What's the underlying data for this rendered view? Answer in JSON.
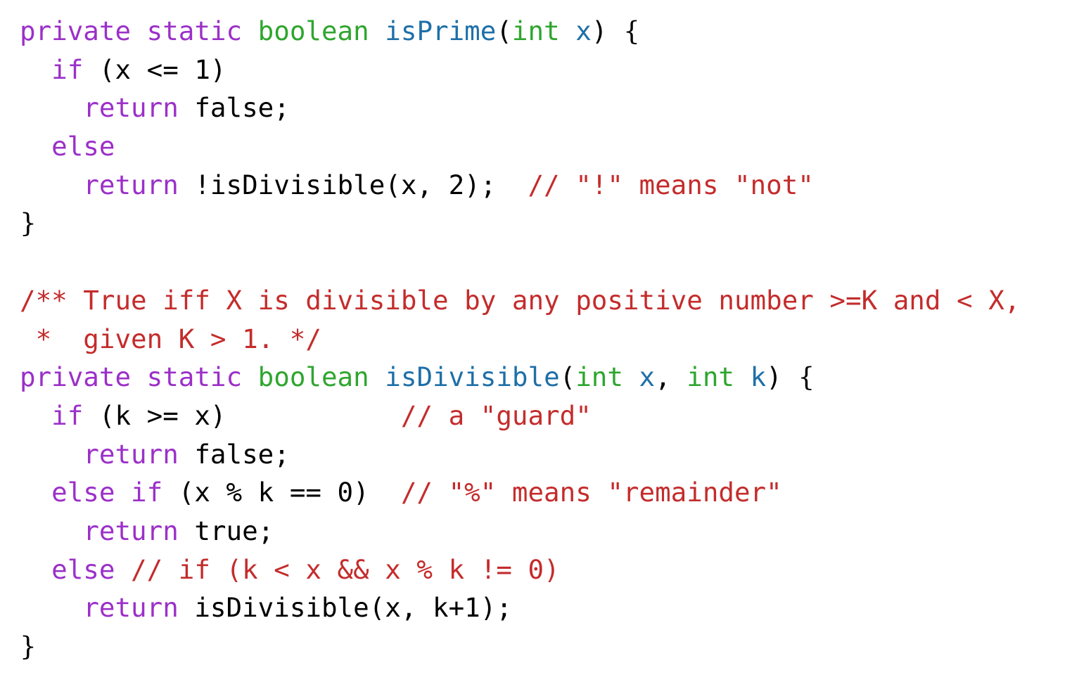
{
  "colors": {
    "keyword": "#9b30c8",
    "type": "#2ea62e",
    "function": "#1e6fa8",
    "comment": "#c42c2c",
    "plain": "#000000"
  },
  "lines": [
    {
      "indent": "",
      "tokens": [
        {
          "text": "private",
          "kind": "keyword"
        },
        {
          "text": " ",
          "kind": "plain"
        },
        {
          "text": "static",
          "kind": "keyword"
        },
        {
          "text": " ",
          "kind": "plain"
        },
        {
          "text": "boolean",
          "kind": "type"
        },
        {
          "text": " ",
          "kind": "plain"
        },
        {
          "text": "isPrime",
          "kind": "function"
        },
        {
          "text": "(",
          "kind": "plain"
        },
        {
          "text": "int",
          "kind": "type"
        },
        {
          "text": " ",
          "kind": "plain"
        },
        {
          "text": "x",
          "kind": "function"
        },
        {
          "text": ") ",
          "kind": "plain"
        },
        {
          "text": "{",
          "kind": "brace"
        }
      ]
    },
    {
      "indent": "  ",
      "tokens": [
        {
          "text": "if",
          "kind": "keyword"
        },
        {
          "text": " (x <= 1)",
          "kind": "plain"
        }
      ]
    },
    {
      "indent": "    ",
      "tokens": [
        {
          "text": "return",
          "kind": "keyword"
        },
        {
          "text": " false;",
          "kind": "plain"
        }
      ]
    },
    {
      "indent": "  ",
      "tokens": [
        {
          "text": "else",
          "kind": "keyword"
        }
      ]
    },
    {
      "indent": "    ",
      "tokens": [
        {
          "text": "return",
          "kind": "keyword"
        },
        {
          "text": " !isDivisible(x, 2);  ",
          "kind": "plain"
        },
        {
          "text": "// \"!\" means \"not\"",
          "kind": "comment"
        }
      ]
    },
    {
      "indent": "",
      "tokens": [
        {
          "text": "}",
          "kind": "brace"
        }
      ]
    },
    {
      "indent": "",
      "tokens": []
    },
    {
      "indent": "",
      "tokens": [
        {
          "text": "/** True iff X is divisible by any positive number >=K and < X,",
          "kind": "comment"
        }
      ]
    },
    {
      "indent": "",
      "tokens": [
        {
          "text": " *  given K > 1. */",
          "kind": "comment"
        }
      ]
    },
    {
      "indent": "",
      "tokens": [
        {
          "text": "private",
          "kind": "keyword"
        },
        {
          "text": " ",
          "kind": "plain"
        },
        {
          "text": "static",
          "kind": "keyword"
        },
        {
          "text": " ",
          "kind": "plain"
        },
        {
          "text": "boolean",
          "kind": "type"
        },
        {
          "text": " ",
          "kind": "plain"
        },
        {
          "text": "isDivisible",
          "kind": "function"
        },
        {
          "text": "(",
          "kind": "plain"
        },
        {
          "text": "int",
          "kind": "type"
        },
        {
          "text": " ",
          "kind": "plain"
        },
        {
          "text": "x",
          "kind": "function"
        },
        {
          "text": ", ",
          "kind": "plain"
        },
        {
          "text": "int",
          "kind": "type"
        },
        {
          "text": " ",
          "kind": "plain"
        },
        {
          "text": "k",
          "kind": "function"
        },
        {
          "text": ") ",
          "kind": "plain"
        },
        {
          "text": "{",
          "kind": "brace"
        }
      ]
    },
    {
      "indent": "  ",
      "tokens": [
        {
          "text": "if",
          "kind": "keyword"
        },
        {
          "text": " (k >= x)           ",
          "kind": "plain"
        },
        {
          "text": "// a \"guard\"",
          "kind": "comment"
        }
      ]
    },
    {
      "indent": "    ",
      "tokens": [
        {
          "text": "return",
          "kind": "keyword"
        },
        {
          "text": " false;",
          "kind": "plain"
        }
      ]
    },
    {
      "indent": "  ",
      "tokens": [
        {
          "text": "else",
          "kind": "keyword"
        },
        {
          "text": " ",
          "kind": "plain"
        },
        {
          "text": "if",
          "kind": "keyword"
        },
        {
          "text": " (x % k == 0)  ",
          "kind": "plain"
        },
        {
          "text": "// \"%\" means \"remainder\"",
          "kind": "comment"
        }
      ]
    },
    {
      "indent": "    ",
      "tokens": [
        {
          "text": "return",
          "kind": "keyword"
        },
        {
          "text": " true;",
          "kind": "plain"
        }
      ]
    },
    {
      "indent": "  ",
      "tokens": [
        {
          "text": "else",
          "kind": "keyword"
        },
        {
          "text": " ",
          "kind": "plain"
        },
        {
          "text": "// if (k < x && x % k != 0)",
          "kind": "comment"
        }
      ]
    },
    {
      "indent": "    ",
      "tokens": [
        {
          "text": "return",
          "kind": "keyword"
        },
        {
          "text": " isDivisible(x, k+1);",
          "kind": "plain"
        }
      ]
    },
    {
      "indent": "",
      "tokens": [
        {
          "text": "}",
          "kind": "brace"
        }
      ]
    }
  ]
}
